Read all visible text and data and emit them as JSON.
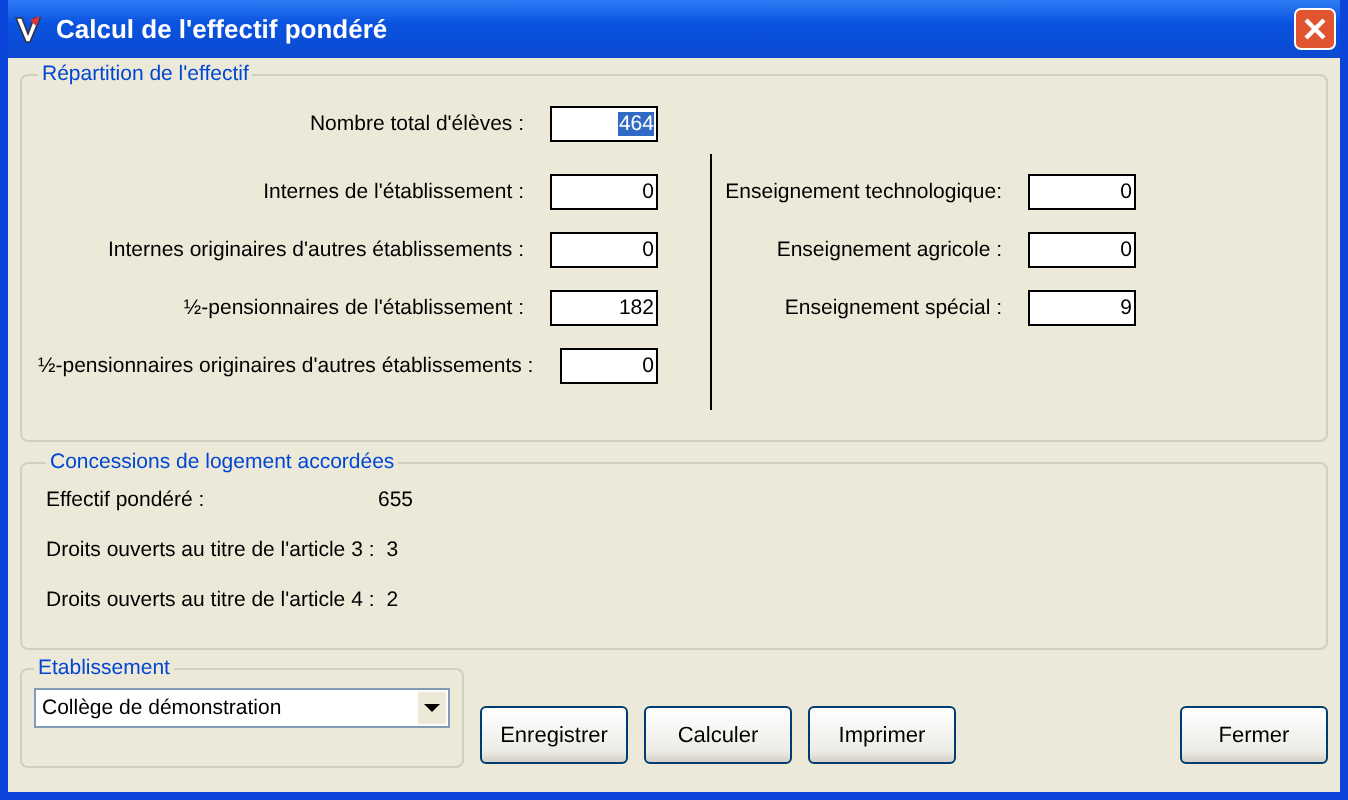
{
  "window": {
    "title": "Calcul de l'effectif pondéré"
  },
  "repartition": {
    "title": "Répartition de l'effectif",
    "total": {
      "label": "Nombre total d'élèves :",
      "value": "464",
      "highlighted": true
    },
    "left_fields": [
      {
        "label": "Internes de l'établissement :",
        "value": "0"
      },
      {
        "label": "Internes originaires d'autres établissements :",
        "value": "0"
      },
      {
        "label": "½-pensionnaires de l'établissement :",
        "value": "182"
      },
      {
        "label": "½-pensionnaires originaires d'autres établissements :",
        "value": "0"
      }
    ],
    "right_fields": [
      {
        "label": "Enseignement technologique:",
        "value": "0"
      },
      {
        "label": "Enseignement agricole :",
        "value": "0"
      },
      {
        "label": "Enseignement spécial :",
        "value": "9"
      }
    ]
  },
  "concessions": {
    "title": "Concessions de logement accordées",
    "rows": [
      {
        "label": "Effectif pondéré :",
        "value": "655"
      },
      {
        "label": "Droits ouverts au titre de l'article 3 :",
        "value": "3"
      },
      {
        "label": "Droits ouverts au titre de l'article 4 :",
        "value": "2"
      }
    ]
  },
  "etablissement": {
    "title": "Etablissement",
    "value": "Collège de démonstration"
  },
  "buttons": [
    "Enregistrer",
    "Calculer",
    "Imprimer"
  ],
  "close_button": "Fermer"
}
